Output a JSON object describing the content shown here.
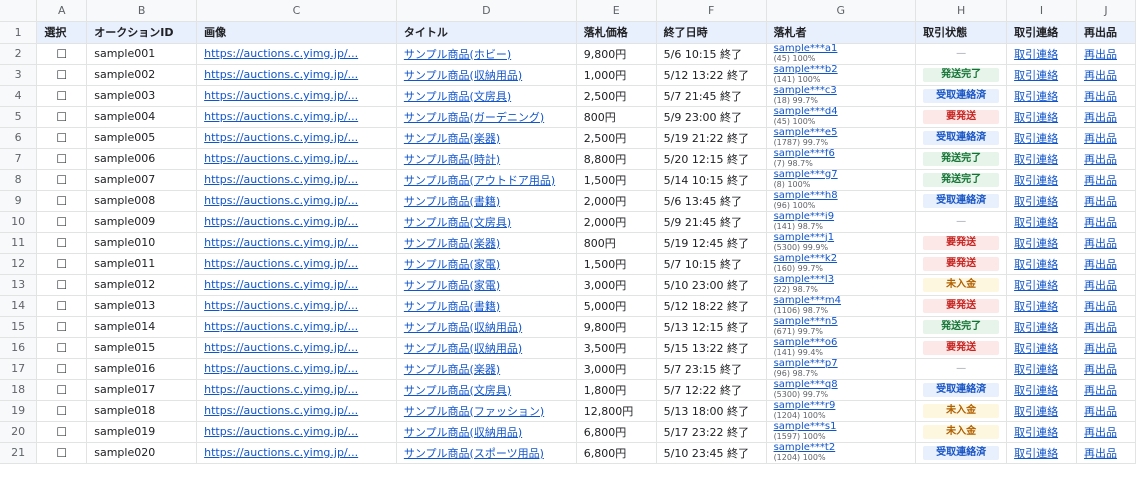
{
  "columns": [
    "A",
    "B",
    "C",
    "D",
    "E",
    "F",
    "G",
    "H",
    "I",
    "J"
  ],
  "header": [
    "選択",
    "オークションID",
    "画像",
    "タイトル",
    "落札価格",
    "終了日時",
    "落札者",
    "取引状態",
    "取引連絡",
    "再出品"
  ],
  "checkbox_glyph": "☐",
  "link_labels": {
    "contact": "取引連絡",
    "relist": "再出品"
  },
  "rows": [
    {
      "num": "2",
      "id": "sample001",
      "img": "https://auctions.c.yimg.jp/...",
      "title": "サンプル商品(ホビー)",
      "price": "9,800円",
      "end": "5/6 10:15 終了",
      "bidder": "sample***a1",
      "meta": "(45) 100%",
      "status": "—",
      "status_color": "none"
    },
    {
      "num": "3",
      "id": "sample002",
      "img": "https://auctions.c.yimg.jp/...",
      "title": "サンプル商品(収納用品)",
      "price": "1,000円",
      "end": "5/12 13:22 終了",
      "bidder": "sample***b2",
      "meta": "(141) 100%",
      "status": "発送完了",
      "status_color": "green"
    },
    {
      "num": "4",
      "id": "sample003",
      "img": "https://auctions.c.yimg.jp/...",
      "title": "サンプル商品(文房具)",
      "price": "2,500円",
      "end": "5/7 21:45 終了",
      "bidder": "sample***c3",
      "meta": "(18) 99.7%",
      "status": "受取連絡済",
      "status_color": "blue"
    },
    {
      "num": "5",
      "id": "sample004",
      "img": "https://auctions.c.yimg.jp/...",
      "title": "サンプル商品(ガーデニング)",
      "price": "800円",
      "end": "5/9 23:00 終了",
      "bidder": "sample***d4",
      "meta": "(45) 100%",
      "status": "要発送",
      "status_color": "red"
    },
    {
      "num": "6",
      "id": "sample005",
      "img": "https://auctions.c.yimg.jp/...",
      "title": "サンプル商品(楽器)",
      "price": "2,500円",
      "end": "5/19 21:22 終了",
      "bidder": "sample***e5",
      "meta": "(1787) 99.7%",
      "status": "受取連絡済",
      "status_color": "blue"
    },
    {
      "num": "7",
      "id": "sample006",
      "img": "https://auctions.c.yimg.jp/...",
      "title": "サンプル商品(時計)",
      "price": "8,800円",
      "end": "5/20 12:15 終了",
      "bidder": "sample***f6",
      "meta": "(7) 98.7%",
      "status": "発送完了",
      "status_color": "green"
    },
    {
      "num": "8",
      "id": "sample007",
      "img": "https://auctions.c.yimg.jp/...",
      "title": "サンプル商品(アウトドア用品)",
      "price": "1,500円",
      "end": "5/14 10:15 終了",
      "bidder": "sample***g7",
      "meta": "(8) 100%",
      "status": "発送完了",
      "status_color": "green"
    },
    {
      "num": "9",
      "id": "sample008",
      "img": "https://auctions.c.yimg.jp/...",
      "title": "サンプル商品(書籍)",
      "price": "2,000円",
      "end": "5/6 13:45 終了",
      "bidder": "sample***h8",
      "meta": "(96) 100%",
      "status": "受取連絡済",
      "status_color": "blue"
    },
    {
      "num": "10",
      "id": "sample009",
      "img": "https://auctions.c.yimg.jp/...",
      "title": "サンプル商品(文房具)",
      "price": "2,000円",
      "end": "5/9 21:45 終了",
      "bidder": "sample***i9",
      "meta": "(141) 98.7%",
      "status": "—",
      "status_color": "none"
    },
    {
      "num": "11",
      "id": "sample010",
      "img": "https://auctions.c.yimg.jp/...",
      "title": "サンプル商品(楽器)",
      "price": "800円",
      "end": "5/19 12:45 終了",
      "bidder": "sample***j1",
      "meta": "(5300) 99.9%",
      "status": "要発送",
      "status_color": "red"
    },
    {
      "num": "12",
      "id": "sample011",
      "img": "https://auctions.c.yimg.jp/...",
      "title": "サンプル商品(家電)",
      "price": "1,500円",
      "end": "5/7 10:15 終了",
      "bidder": "sample***k2",
      "meta": "(160) 99.7%",
      "status": "要発送",
      "status_color": "red"
    },
    {
      "num": "13",
      "id": "sample012",
      "img": "https://auctions.c.yimg.jp/...",
      "title": "サンプル商品(家電)",
      "price": "3,000円",
      "end": "5/10 23:00 終了",
      "bidder": "sample***l3",
      "meta": "(22) 98.7%",
      "status": "未入金",
      "status_color": "yellow"
    },
    {
      "num": "14",
      "id": "sample013",
      "img": "https://auctions.c.yimg.jp/...",
      "title": "サンプル商品(書籍)",
      "price": "5,000円",
      "end": "5/12 18:22 終了",
      "bidder": "sample***m4",
      "meta": "(1106) 98.7%",
      "status": "要発送",
      "status_color": "red"
    },
    {
      "num": "15",
      "id": "sample014",
      "img": "https://auctions.c.yimg.jp/...",
      "title": "サンプル商品(収納用品)",
      "price": "9,800円",
      "end": "5/13 12:15 終了",
      "bidder": "sample***n5",
      "meta": "(671) 99.7%",
      "status": "発送完了",
      "status_color": "green"
    },
    {
      "num": "16",
      "id": "sample015",
      "img": "https://auctions.c.yimg.jp/...",
      "title": "サンプル商品(収納用品)",
      "price": "3,500円",
      "end": "5/15 13:22 終了",
      "bidder": "sample***o6",
      "meta": "(141) 99.4%",
      "status": "要発送",
      "status_color": "red"
    },
    {
      "num": "17",
      "id": "sample016",
      "img": "https://auctions.c.yimg.jp/...",
      "title": "サンプル商品(楽器)",
      "price": "3,000円",
      "end": "5/7 23:15 終了",
      "bidder": "sample***p7",
      "meta": "(96) 98.7%",
      "status": "—",
      "status_color": "none"
    },
    {
      "num": "18",
      "id": "sample017",
      "img": "https://auctions.c.yimg.jp/...",
      "title": "サンプル商品(文房具)",
      "price": "1,800円",
      "end": "5/7 12:22 終了",
      "bidder": "sample***q8",
      "meta": "(5300) 99.7%",
      "status": "受取連絡済",
      "status_color": "blue"
    },
    {
      "num": "19",
      "id": "sample018",
      "img": "https://auctions.c.yimg.jp/...",
      "title": "サンプル商品(ファッション)",
      "price": "12,800円",
      "end": "5/13 18:00 終了",
      "bidder": "sample***r9",
      "meta": "(1204) 100%",
      "status": "未入金",
      "status_color": "yellow"
    },
    {
      "num": "20",
      "id": "sample019",
      "img": "https://auctions.c.yimg.jp/...",
      "title": "サンプル商品(収納用品)",
      "price": "6,800円",
      "end": "5/17 23:22 終了",
      "bidder": "sample***s1",
      "meta": "(1597) 100%",
      "status": "未入金",
      "status_color": "yellow"
    },
    {
      "num": "21",
      "id": "sample020",
      "img": "https://auctions.c.yimg.jp/...",
      "title": "サンプル商品(スポーツ用品)",
      "price": "6,800円",
      "end": "5/10 23:45 終了",
      "bidder": "sample***t2",
      "meta": "(1204) 100%",
      "status": "受取連絡済",
      "status_color": "blue"
    }
  ],
  "colors": {
    "header_bg": "#e8f0fe",
    "link": "#1155cc",
    "green": "#137333",
    "blue": "#1a56c4",
    "red": "#c5221f",
    "yellow": "#b06000"
  }
}
